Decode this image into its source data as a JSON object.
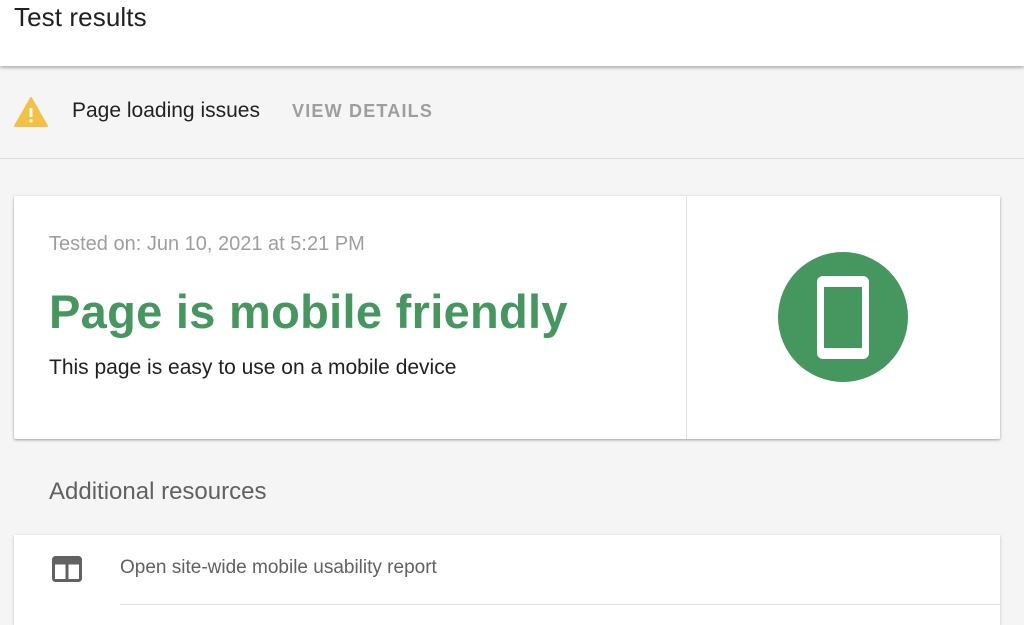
{
  "header": {
    "title": "Test results"
  },
  "issues_bar": {
    "icon": "warning-icon",
    "icon_color": "#f4c147",
    "label": "Page loading issues",
    "action_label": "VIEW DETAILS"
  },
  "result": {
    "tested_on": "Tested on: Jun 10, 2021 at 5:21 PM",
    "verdict": "Page is mobile friendly",
    "description": "This page is easy to use on a mobile device",
    "status_icon": "mobile-phone-icon",
    "status_color": "#45975f"
  },
  "resources": {
    "heading": "Additional resources",
    "items": [
      {
        "icon": "report-icon",
        "label": "Open site-wide mobile usability report"
      }
    ]
  }
}
